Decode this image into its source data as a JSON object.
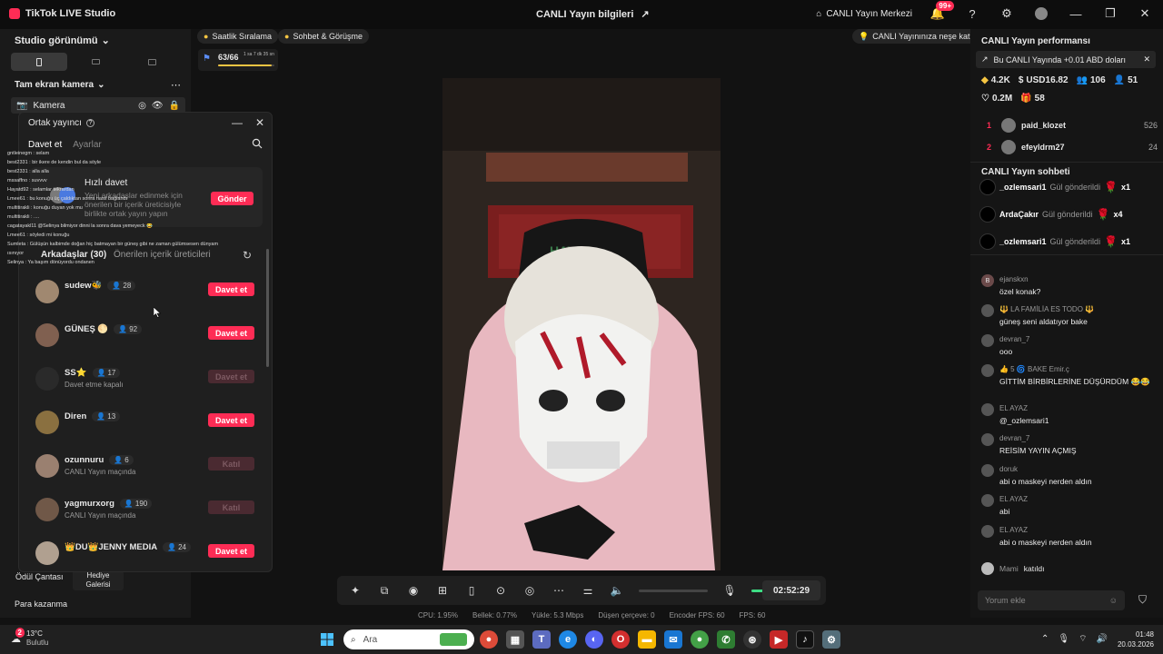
{
  "titlebar": {
    "app_name": "TikTok LIVE Studio",
    "center_title": "CANLI Yayın bilgileri",
    "live_center": "CANLI Yayın Merkezi",
    "notif_badge": "99+"
  },
  "left": {
    "studio_view": "Studio görünümü",
    "scene": "Tam ekran kamera",
    "camera": "Kamera",
    "gift_bag": "Ödül Çantası",
    "gift_gallery": "Hediye Galerisi",
    "earn": "Para kazanma"
  },
  "modal": {
    "title": "Ortak yayıncı",
    "tab_invite": "Davet et",
    "tab_settings": "Ayarlar",
    "quick_title": "Hızlı davet",
    "quick_desc": "Yeni arkadaşlar edinmek için önerilen bir içerik üreticisiyle birlikte ortak yayın yapın",
    "send": "Gönder",
    "friends_tab": "Arkadaşlar (30)",
    "suggested_tab": "Önerilen içerik üreticileri",
    "friends": [
      {
        "name": "sudew🐝",
        "count": "28",
        "sub": "",
        "action": "Davet et",
        "enabled": true,
        "color": "#a08870"
      },
      {
        "name": "GÜNEŞ 🌕",
        "count": "92",
        "sub": "",
        "action": "Davet et",
        "enabled": true,
        "color": "#806050"
      },
      {
        "name": "SS⭐",
        "count": "17",
        "sub": "Davet etme kapalı",
        "action": "Davet et",
        "enabled": false,
        "color": "#2a2a2a"
      },
      {
        "name": "Diren",
        "count": "13",
        "sub": "",
        "action": "Davet et",
        "enabled": true,
        "color": "#8a7040"
      },
      {
        "name": "ozunnuru",
        "count": "6",
        "sub": "CANLI Yayın maçında",
        "action": "Katıl",
        "enabled": false,
        "color": "#9a8070"
      },
      {
        "name": "yagmurxorg",
        "count": "190",
        "sub": "CANLI Yayın maçında",
        "action": "Katıl",
        "enabled": false,
        "color": "#705848"
      },
      {
        "name": "👑DU👑JENNY MEDIA",
        "count": "24",
        "sub": "",
        "action": "Davet et",
        "enabled": true,
        "color": "#b0a090"
      }
    ]
  },
  "overlay_chat": [
    "gntleinegm : selam",
    "best2331 : bir ikere de kendin bul da söyle",
    "best2331 : alla alla",
    "mssaffno : suvvvv",
    "Hayatd92 : selamlar tekrardan",
    "Lmee61 : bu konuğu üç çaldıktan sonra nasıl bağlandı",
    "multitirakli : konuğu duyan yok mu",
    "multitirakli : ....",
    "cagatayakl11 @Selinya bilmiyor dinni la sonra dava yemeyeck 😂",
    "Lmee61 : söyledi mi konuğu",
    "Sumleta : Gülüşün kalbimde doğan hiç batmayan bir güneş gibi ne zaman gülümsesen dünyam",
    "ısınıyor",
    "Selinya : Ya başım dönüyordu ondanen"
  ],
  "center": {
    "pill_hourly": "Saatlik Sıralama",
    "pill_chat": "Sohbet & Görüşme",
    "pill_fun": "CANLI Yayınınıza neşe katın",
    "goal_value": "63/66",
    "goal_time": "1 sa 7 dk 35 sn",
    "goal_progress": 0.95,
    "timer": "02:52:29",
    "mic_level": 0.65
  },
  "stats": {
    "cpu": "CPU: 1.95%",
    "memory": "Bellek: 0.77%",
    "upload": "Yükle: 5.3 Mbps",
    "dropped": "Düşen çerçeve: 0",
    "encoder_fps": "Encoder FPS: 60",
    "fps": "FPS: 60"
  },
  "right": {
    "perf_title": "CANLI Yayın performansı",
    "earn_note": "Bu CANLI Yayında +0.01 ABD doları",
    "metrics": {
      "diamonds": "4.2K",
      "usd": "USD16.82",
      "gifters": "106",
      "viewers": "51",
      "likes": "0.2M",
      "gifts": "58"
    },
    "ranking": [
      {
        "rank": "1",
        "name": "paid_klozet",
        "value": "526"
      },
      {
        "rank": "2",
        "name": "efeyldrm27",
        "value": "24"
      }
    ],
    "chat_title": "CANLI Yayın sohbeti",
    "gifts": [
      {
        "user": "_ozlemsari1",
        "text": "Gül gönderildi",
        "mult": "x1"
      },
      {
        "user": "ArdaÇakır",
        "text": "Gül gönderildi",
        "mult": "x4"
      },
      {
        "user": "_ozlemsari1",
        "text": "Gül gönderildi",
        "mult": "x1"
      }
    ],
    "messages": [
      {
        "user": "ejanskxn",
        "text": "özel konak?",
        "initial": "B"
      },
      {
        "user": "🔱 LA FAMİLİA ES TODO 🔱",
        "text": "güneş seni aldatıyor bake",
        "initial": ""
      },
      {
        "user": "devran_7",
        "text": "ooo",
        "initial": ""
      },
      {
        "user": "👍 5 🌀 BAKE Emir.ç",
        "text": "GİTTİM BİRBİRLERİNE DÜŞÜRDÜM 😂😂",
        "initial": ""
      },
      {
        "user": "EL AYAZ",
        "text": "@_ozlemsari1",
        "initial": ""
      },
      {
        "user": "devran_7",
        "text": "REİSİM YAYIN AÇMIŞ",
        "initial": ""
      },
      {
        "user": "doruk",
        "text": "abi o maskeyi nerden aldın",
        "initial": ""
      },
      {
        "user": "EL AYAZ",
        "text": "abi",
        "initial": ""
      },
      {
        "user": "EL AYAZ",
        "text": "abi o maskeyi nerden aldın",
        "initial": ""
      }
    ],
    "joined_user": "Mami",
    "joined_text": "katıldı",
    "comment_placeholder": "Yorum ekle"
  },
  "taskbar": {
    "weather_temp": "13°C",
    "weather_desc": "Bulutlu",
    "weather_badge": "2",
    "search": "Ara",
    "time": "01:48",
    "date": "20.03.2026"
  },
  "colors": {
    "accent": "#fe2c55",
    "bg": "#121212"
  }
}
